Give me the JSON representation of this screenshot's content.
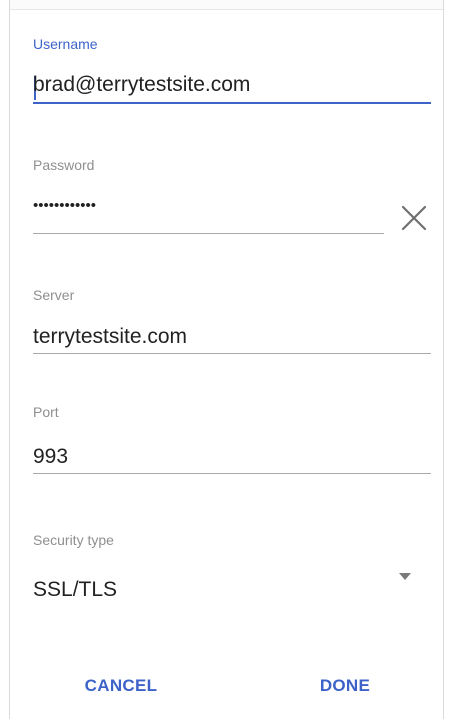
{
  "form": {
    "username": {
      "label": "Username",
      "value": "brad@terrytestsite.com"
    },
    "password": {
      "label": "Password",
      "value": "••••••••••••",
      "clear_icon": "close-icon"
    },
    "server": {
      "label": "Server",
      "value": "terrytestsite.com"
    },
    "port": {
      "label": "Port",
      "value": "993"
    },
    "security": {
      "label": "Security type",
      "value": "SSL/TLS",
      "dropdown_icon": "dropdown-arrow-icon"
    }
  },
  "actions": {
    "cancel_label": "CANCEL",
    "done_label": "DONE"
  },
  "colors": {
    "accent": "#3d63c9",
    "label": "#8f8f8f",
    "text": "#222222",
    "divider": "#a9a9a9"
  }
}
